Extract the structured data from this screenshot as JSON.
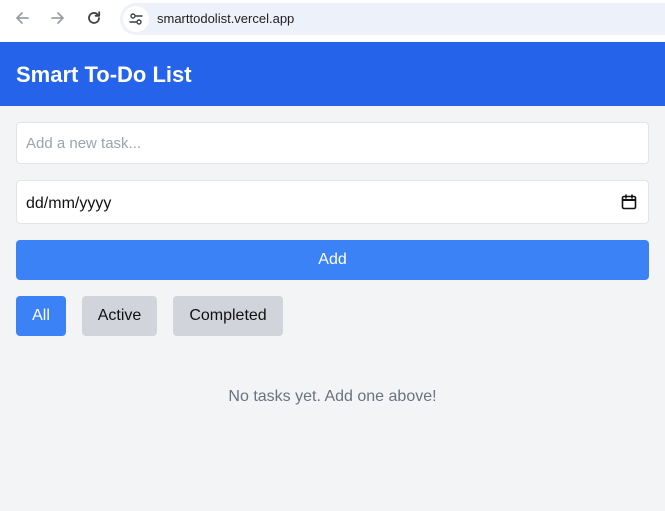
{
  "browser": {
    "url": "smarttodolist.vercel.app",
    "icons": {
      "back": "arrow-left-icon",
      "forward": "arrow-right-icon",
      "reload": "reload-icon",
      "site_info": "tune-icon"
    }
  },
  "app": {
    "title": "Smart To-Do List",
    "colors": {
      "header": "#2563eb",
      "primary": "#3b82f6",
      "secondary": "#d1d5db",
      "background": "#f3f4f6",
      "muted_text": "#6b7280"
    }
  },
  "form": {
    "task_placeholder": "Add a new task...",
    "task_value": "",
    "date_value": "dd/mm/yyyy",
    "date_icon": "calendar-icon",
    "add_label": "Add"
  },
  "filters": {
    "items": [
      {
        "label": "All",
        "selected": true
      },
      {
        "label": "Active",
        "selected": false
      },
      {
        "label": "Completed",
        "selected": false
      }
    ]
  },
  "tasks": {
    "items": [],
    "empty_message": "No tasks yet. Add one above!"
  }
}
